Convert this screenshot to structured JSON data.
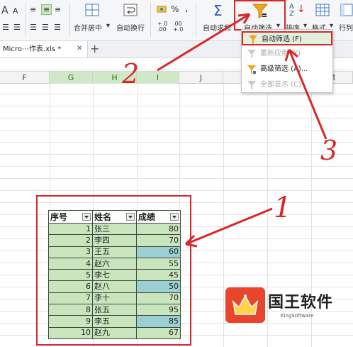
{
  "ribbon": {
    "merge_center_label": "合并居中",
    "wrap_text_label": "自动换行",
    "autosum_label": "自动求和",
    "autofilter_label": "自动筛选",
    "sort_label": "排序",
    "format_label": "格式",
    "rowcol_label": "行列",
    "font_glyph_a_large": "A",
    "font_glyph_a_small": "A",
    "percent_glyph": "%",
    "comma_glyph": ",",
    "dec_increase_glyph": "+.0\n.00",
    "dec_decrease_glyph": ".00\n+.0",
    "sum_glyph": "Σ",
    "sort_glyph": "A\nZ"
  },
  "tabs": {
    "doc_tab_label": "Micro⋯作表.xls *",
    "close_glyph": "✕",
    "add_glyph": "+"
  },
  "columns": [
    "F",
    "G",
    "H",
    "I",
    "J",
    "K",
    "L",
    "M"
  ],
  "selected_columns": [
    "G",
    "H",
    "I"
  ],
  "dropdown": {
    "items": [
      {
        "label": "自动筛选 (F)",
        "state": "active",
        "icon": "funnel-icon"
      },
      {
        "label": "重新应用 (Y)",
        "state": "disabled",
        "icon": "funnel-refresh-icon"
      },
      {
        "label": "高级筛选 (A)...",
        "state": "normal",
        "icon": "funnel-advanced-icon"
      },
      {
        "label": "全部显示 (C)",
        "state": "disabled",
        "icon": "funnel-clear-icon"
      }
    ]
  },
  "table": {
    "headers": [
      "序号",
      "姓名",
      "成绩"
    ],
    "rows": [
      {
        "no": "1",
        "name": "张三",
        "score": "80",
        "highlight": false
      },
      {
        "no": "2",
        "name": "李四",
        "score": "70",
        "highlight": false
      },
      {
        "no": "3",
        "name": "王五",
        "score": "60",
        "highlight": true
      },
      {
        "no": "4",
        "name": "赵六",
        "score": "55",
        "highlight": false
      },
      {
        "no": "5",
        "name": "李七",
        "score": "45",
        "highlight": false
      },
      {
        "no": "6",
        "name": "赵八",
        "score": "50",
        "highlight": true
      },
      {
        "no": "7",
        "name": "李十",
        "score": "70",
        "highlight": false
      },
      {
        "no": "8",
        "name": "张五",
        "score": "95",
        "highlight": false
      },
      {
        "no": "9",
        "name": "李五",
        "score": "85",
        "highlight": true
      },
      {
        "no": "10",
        "name": "赵九",
        "score": "67",
        "highlight": false
      }
    ]
  },
  "annotations": {
    "step1": "1",
    "step2": "2",
    "step3": "3"
  },
  "logo": {
    "title": "国王软件",
    "subtitle": "KingSoftware"
  },
  "colors": {
    "annotation_red": "#d6282b",
    "cell_green": "#c9e5be",
    "cell_highlight": "#9ccfd3",
    "logo_orange": "#e8452c"
  }
}
